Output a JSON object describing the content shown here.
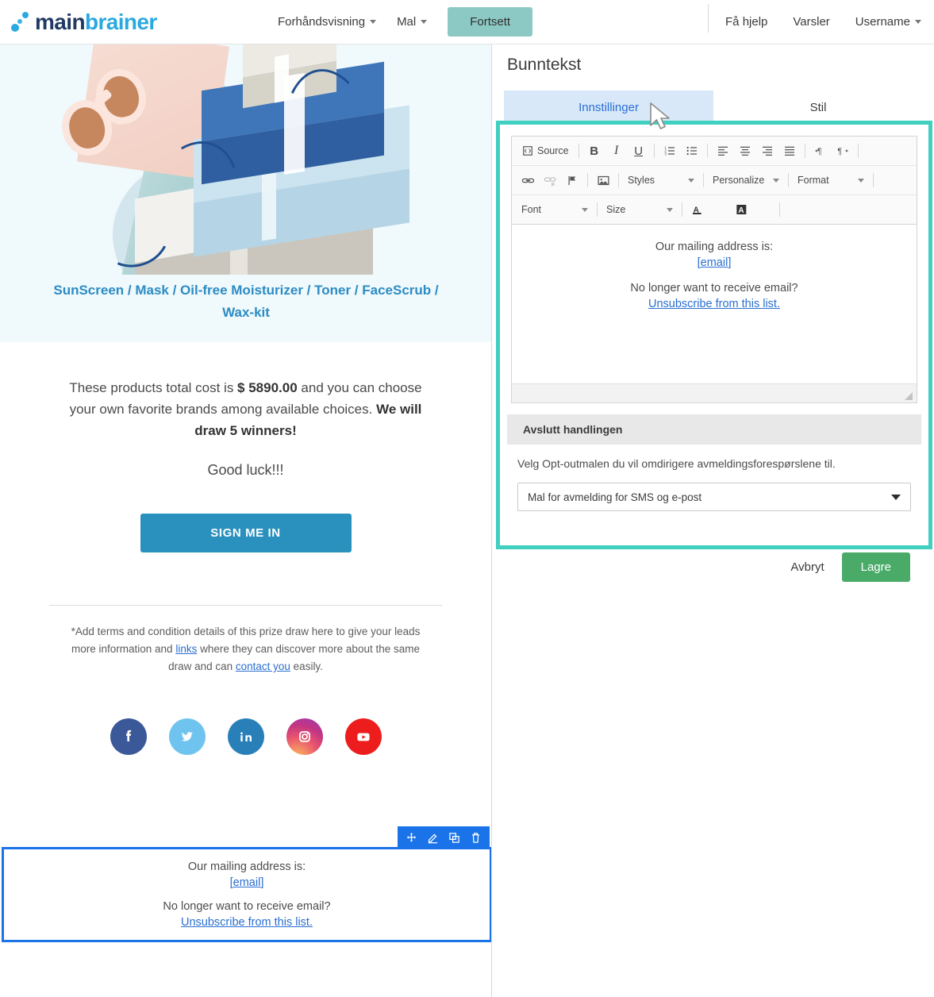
{
  "header": {
    "logo": {
      "part1": "main",
      "part2": "brainer"
    },
    "nav": [
      {
        "label": "Forhåndsvisning",
        "has_caret": true
      },
      {
        "label": "Mal",
        "has_caret": true
      }
    ],
    "primary_button": "Fortsett",
    "right_nav": [
      {
        "label": "Få hjelp",
        "has_caret": false
      },
      {
        "label": "Varsler",
        "has_caret": false
      },
      {
        "label": "Username",
        "has_caret": true
      }
    ]
  },
  "preview": {
    "hero_caption": "SunScreen / Mask / Oil-free Moisturizer / Toner / FaceScrub / Wax-kit",
    "body_part1": "These products total cost is ",
    "body_bold1": "$ 5890.00",
    "body_part2": " and you can choose your own favorite brands among available choices. ",
    "body_bold2": "We will draw 5 winners!",
    "good_luck": "Good luck!!!",
    "cta_label": "SIGN ME IN",
    "terms_part1": "*Add terms and condition details of this prize draw here to give your leads more information and ",
    "terms_link1": "links",
    "terms_part2": " where they can discover more about the same draw and can ",
    "terms_link2": "contact you",
    "terms_part3": " easily.",
    "socials": [
      {
        "name": "facebook-icon",
        "color": "#3b5998"
      },
      {
        "name": "twitter-icon",
        "color": "#6fc4ef"
      },
      {
        "name": "linkedin-icon",
        "color": "#2980b9"
      },
      {
        "name": "instagram-icon",
        "color": "#c13584"
      },
      {
        "name": "youtube-icon",
        "color": "#ee1d1d"
      }
    ],
    "selected_block": {
      "line1": "Our mailing address is:",
      "link1": "[email]",
      "line2": "No longer want to receive email?",
      "link2": "Unsubscribe from this list.",
      "toolbar": [
        "move-icon",
        "edit-icon",
        "duplicate-icon",
        "delete-icon"
      ]
    }
  },
  "settings": {
    "title": "Bunntekst",
    "tabs": [
      {
        "label": "Innstillinger",
        "active": true
      },
      {
        "label": "Stil",
        "active": false
      }
    ],
    "editor": {
      "toolbar_row1": [
        "Source",
        "B",
        "I",
        "U",
        "numbered-list-icon",
        "bulleted-list-icon",
        "align-left-icon",
        "align-center-icon",
        "align-right-icon",
        "align-justify-icon",
        "ltr-icon",
        "rtl-icon"
      ],
      "source_label": "Source",
      "toolbar_row2_dropdowns": [
        "Styles",
        "Personalize",
        "Format"
      ],
      "toolbar_row3_dropdowns": [
        "Font",
        "Size"
      ],
      "content": {
        "line1": "Our mailing address is:",
        "link1": "[email]",
        "line2": "No longer want to receive email?",
        "link2": "Unsubscribe from this list."
      }
    },
    "section": {
      "heading": "Avslutt handlingen",
      "description": "Velg Opt-outmalen du vil omdirigere avmeldingsforespørslene til.",
      "select_value": "Mal for avmelding for SMS og e-post"
    },
    "cancel_label": "Avbryt",
    "save_label": "Lagre"
  },
  "colors": {
    "brand_blue": "#2aa9e0",
    "brand_navy": "#203a63",
    "continue_btn": "#8dc9c4",
    "save_btn": "#4aab69",
    "cta_blue": "#2a91bf",
    "highlight_teal": "#3fd0c0",
    "selection_blue": "#1a73e8",
    "tab_active_bg": "#d9e8f9"
  }
}
